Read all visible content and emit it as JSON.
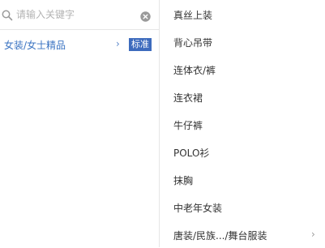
{
  "search": {
    "placeholder": "请输入关键字",
    "value": ""
  },
  "category": {
    "label": "女装/女士精品",
    "chevron": "›",
    "badge": "标准"
  },
  "subcategories": [
    {
      "label": "真丝上装"
    },
    {
      "label": "背心吊带"
    },
    {
      "label": "连体衣/裤"
    },
    {
      "label": "连衣裙"
    },
    {
      "label": "牛仔裤"
    },
    {
      "label": "POLO衫"
    },
    {
      "label": "抹胸"
    },
    {
      "label": "中老年女装"
    },
    {
      "label": "唐装/民族.../舞台服装",
      "chevron": "›"
    }
  ],
  "colors": {
    "accent": "#3a73c2",
    "badge_bg": "#3d6bbd",
    "divider": "#e6e6e6"
  }
}
